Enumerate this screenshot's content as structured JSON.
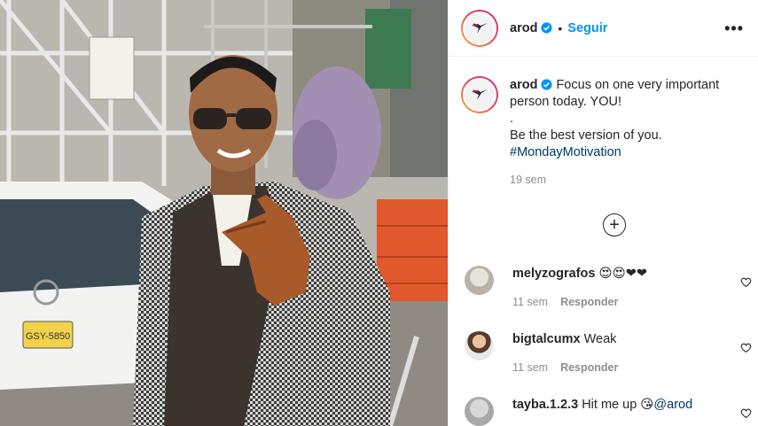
{
  "post": {
    "username": "arod",
    "follow_label": "Seguir",
    "more_label": "•••",
    "verified_icon": "verified-badge-icon"
  },
  "caption": {
    "username": "arod",
    "lines": [
      "Focus on one very important person today. YOU!",
      ".",
      "Be the best version of you."
    ],
    "hashtag": "#MondayMotivation",
    "time": "19 sem"
  },
  "load_more_label": "+",
  "comments": [
    {
      "username": "melyzografos",
      "text": "😍😍❤❤",
      "time": "11 sem",
      "reply_label": "Responder"
    },
    {
      "username": "bigtalcumx",
      "text": "Weak",
      "time": "11 sem",
      "reply_label": "Responder"
    },
    {
      "username": "tayba.1.2.3",
      "text": "Hit me up 😘",
      "mention": "@arod"
    }
  ],
  "colors": {
    "accent": "#0095f6",
    "hashtag": "#00376b",
    "muted": "#8e8e8e"
  }
}
